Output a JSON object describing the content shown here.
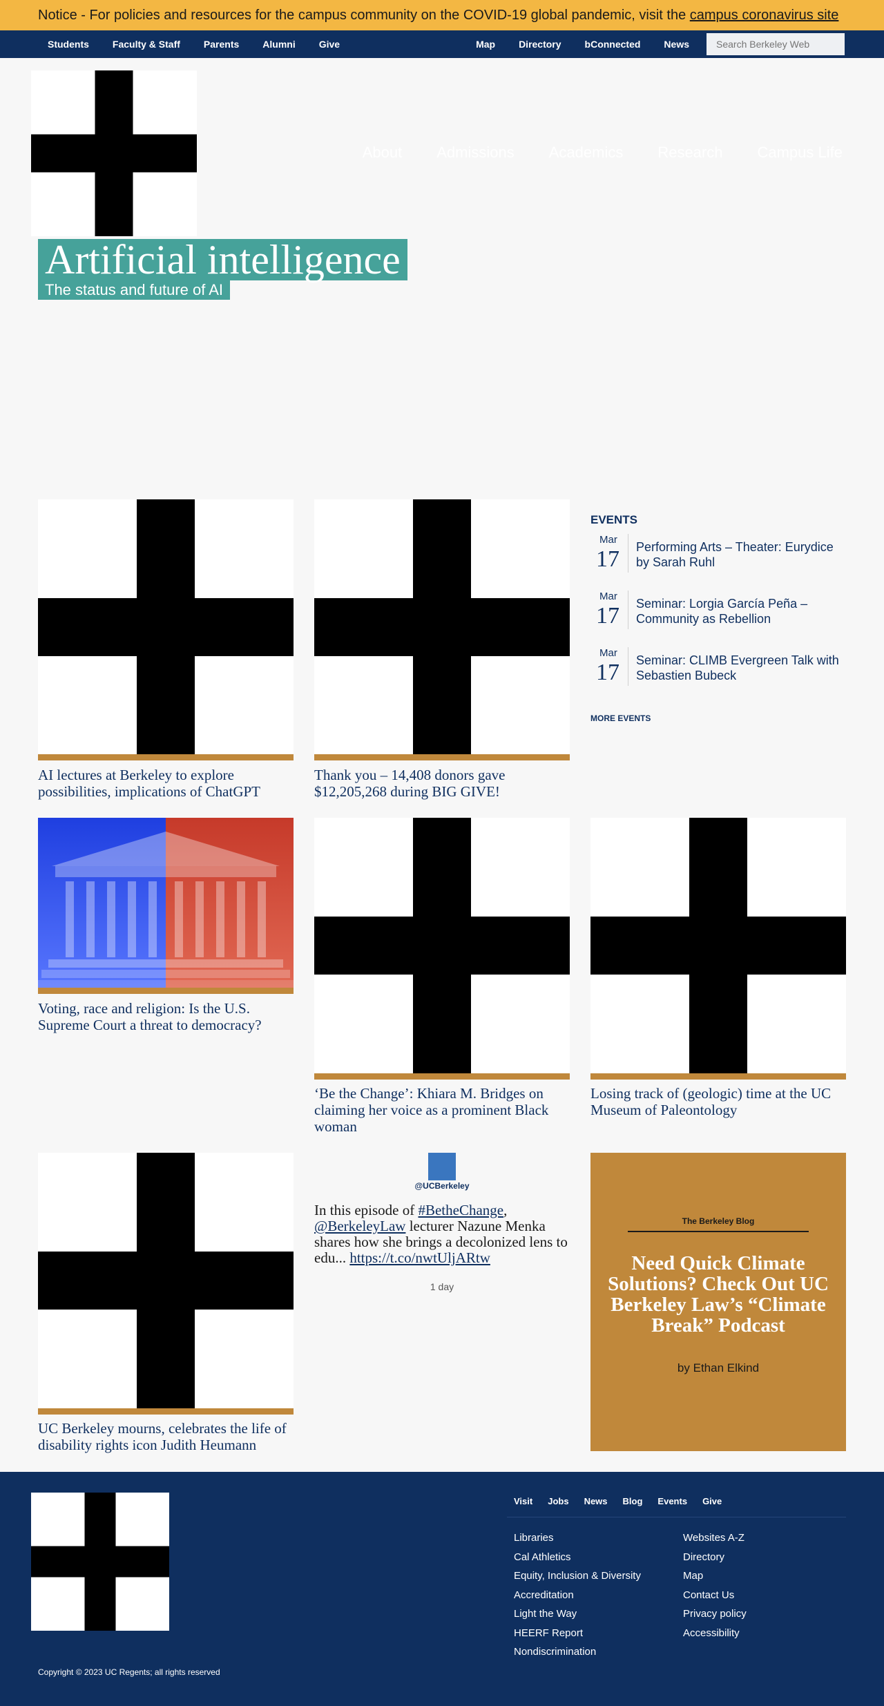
{
  "notice": {
    "text": "Notice - For policies and resources for the campus community on the COVID-19 global pandemic, visit the ",
    "link": "campus coronavirus site"
  },
  "utility_nav": {
    "left": [
      "Students",
      "Faculty & Staff",
      "Parents",
      "Alumni",
      "Give"
    ],
    "right": [
      "Map",
      "Directory",
      "bConnected",
      "News"
    ],
    "search_placeholder": "Search Berkeley Web"
  },
  "main_nav": [
    "About",
    "Admissions",
    "Academics",
    "Research",
    "Campus Life"
  ],
  "hero": {
    "title": "Artificial intelligence",
    "subtitle": "The status and future of AI"
  },
  "stories": [
    {
      "caption": "AI lectures at Berkeley to explore possibilities, implications of ChatGPT"
    },
    {
      "caption": "Thank you – 14,408 donors gave $12,205,268 during BIG GIVE!"
    },
    {
      "caption": "Voting, race and religion: Is the U.S. Supreme Court a threat to democracy?"
    },
    {
      "caption": "‘Be the Change’: Khiara M. Bridges on claiming her voice as a prominent Black woman"
    },
    {
      "caption": "Losing track of (geologic) time at the UC Museum of Paleontology"
    },
    {
      "caption": "UC Berkeley mourns, celebrates the life of disability rights icon Judith Heumann"
    }
  ],
  "events": {
    "heading": "EVENTS",
    "items": [
      {
        "month": "Mar",
        "day": "17",
        "title": "Performing Arts – Theater: Eurydice by Sarah Ruhl"
      },
      {
        "month": "Mar",
        "day": "17",
        "title": "Seminar: Lorgia García Peña – Community as Rebellion"
      },
      {
        "month": "Mar",
        "day": "17",
        "title": "Seminar: CLIMB Evergreen Talk with Sebastien Bubeck"
      }
    ],
    "more": "MORE EVENTS"
  },
  "tweet": {
    "handle": "@UCBerkeley",
    "text_1": "In this episode of ",
    "hashtag": "#BetheChange",
    "text_2": ", ",
    "mention": "@BerkeleyLaw",
    "text_3": " lecturer Nazune Menka shares how she brings a decolonized lens to edu... ",
    "url": "https://t.co/nwtUljARtw",
    "time": "1 day"
  },
  "blog": {
    "label": "The Berkeley Blog",
    "title": "Need Quick Climate Solutions? Check Out UC Berkeley Law’s “Climate Break” Podcast",
    "author": "by Ethan Elkind"
  },
  "footer": {
    "nav": [
      "Visit",
      "Jobs",
      "News",
      "Blog",
      "Events",
      "Give"
    ],
    "col1": [
      "Libraries",
      "Cal Athletics",
      "Equity, Inclusion & Diversity",
      "Accreditation",
      "Light the Way",
      "HEERF Report",
      "Nondiscrimination"
    ],
    "col2": [
      "Websites A-Z",
      "Directory",
      "Map",
      "Contact Us",
      "Privacy policy",
      "Accessibility"
    ],
    "copyright": "Copyright © 2023 UC Regents; all rights reserved"
  },
  "colors": {
    "notice": "#f3b743",
    "navy": "#0f2f5f",
    "teal": "#46a29a",
    "gold": "#c0883b"
  }
}
